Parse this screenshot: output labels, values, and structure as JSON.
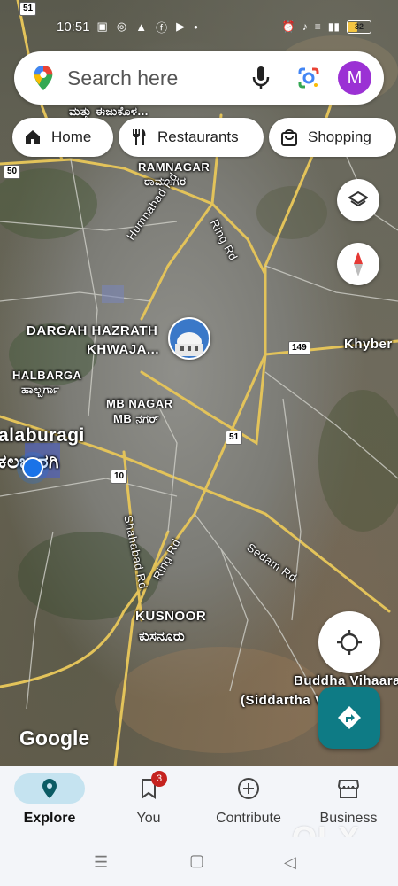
{
  "status": {
    "time": "10:51",
    "battery": "32"
  },
  "search": {
    "placeholder": "Search here",
    "avatar_initial": "M"
  },
  "chips": [
    {
      "label": "Home",
      "icon": "home-icon"
    },
    {
      "label": "Restaurants",
      "icon": "fork-knife-icon"
    },
    {
      "label": "Shopping",
      "icon": "shopping-bag-icon"
    }
  ],
  "map": {
    "labels": {
      "ramnagar": "RAMNAGAR",
      "ramnagar_kn": "ರಾಮನಗರ",
      "dargah_1": "DARGAH HAZRATH",
      "dargah_2": "KHWAJA...",
      "halbarga": "HALBARGA",
      "halbarga_kn": "ಹಾಲ್ಬರ್ಗಾ",
      "mb_nagar": "MB NAGAR",
      "mb_nagar_kn": "MB ನಗರ್",
      "kalaburagi": "alaburagi",
      "kalaburagi_kn": "ಕಲಬುರಗಿ",
      "kusnoor": "KUSNOOR",
      "kusnoor_kn": "ಕುಸನೂರು",
      "khyber": "Khyber",
      "buddha_1": "Buddha Vihaara",
      "buddha_2": "(Siddartha V...",
      "top_kn": "ಮತ್ತು ಈಜುಕೊಳ...",
      "humnabad_rd": "Humnabad Rd",
      "ring_rd_1": "Ring Rd",
      "ring_rd_2": "Ring Rd",
      "sedam_rd": "Sedam Rd",
      "shahabad_rd": "Shahabad Rd"
    },
    "shields": {
      "nh50": "50",
      "nh51_top": "51",
      "nh149": "149",
      "nh51": "51",
      "nh10": "10"
    },
    "google_logo": "Google"
  },
  "nav": {
    "items": [
      {
        "label": "Explore",
        "icon": "explore-pin-icon",
        "active": true
      },
      {
        "label": "You",
        "icon": "bookmark-icon",
        "badge": "3"
      },
      {
        "label": "Contribute",
        "icon": "plus-circle-icon"
      },
      {
        "label": "Business",
        "icon": "storefront-icon"
      }
    ]
  },
  "watermark": "OLX"
}
